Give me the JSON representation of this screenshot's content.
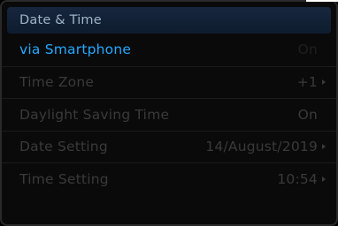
{
  "header": {
    "title": "Date & Time"
  },
  "rows": [
    {
      "label": "via Smartphone",
      "value": "On",
      "has_chevron": false
    },
    {
      "label": "Time Zone",
      "value": "+1",
      "has_chevron": true
    },
    {
      "label": "Daylight Saving Time",
      "value": "On",
      "has_chevron": false
    },
    {
      "label": "Date Setting",
      "value": "14/August/2019",
      "has_chevron": true
    },
    {
      "label": "Time Setting",
      "value": "10:54",
      "has_chevron": true
    }
  ],
  "colors": {
    "active_label": "#23a9ff",
    "inactive_text": "#3a3a3a",
    "header_bg": "#16263d",
    "background": "#0a0a0a"
  }
}
